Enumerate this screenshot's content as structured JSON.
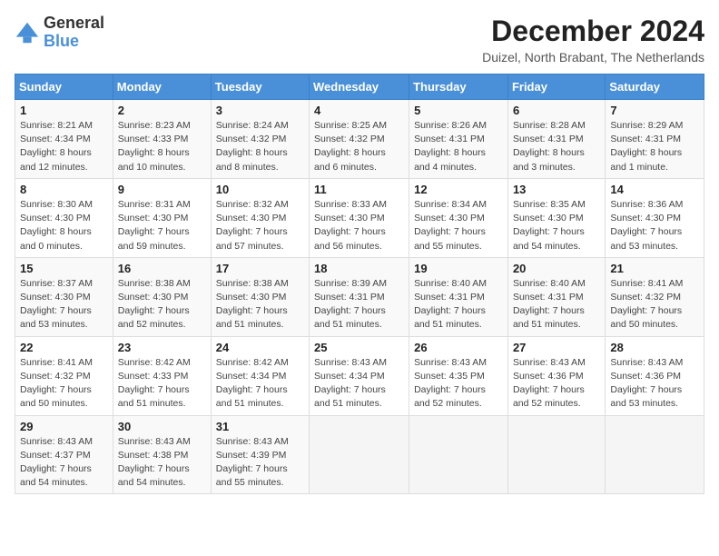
{
  "header": {
    "logo_general": "General",
    "logo_blue": "Blue",
    "title": "December 2024",
    "subtitle": "Duizel, North Brabant, The Netherlands"
  },
  "columns": [
    "Sunday",
    "Monday",
    "Tuesday",
    "Wednesday",
    "Thursday",
    "Friday",
    "Saturday"
  ],
  "weeks": [
    [
      {
        "day": "1",
        "sunrise": "8:21 AM",
        "sunset": "4:34 PM",
        "daylight": "8 hours and 12 minutes."
      },
      {
        "day": "2",
        "sunrise": "8:23 AM",
        "sunset": "4:33 PM",
        "daylight": "8 hours and 10 minutes."
      },
      {
        "day": "3",
        "sunrise": "8:24 AM",
        "sunset": "4:32 PM",
        "daylight": "8 hours and 8 minutes."
      },
      {
        "day": "4",
        "sunrise": "8:25 AM",
        "sunset": "4:32 PM",
        "daylight": "8 hours and 6 minutes."
      },
      {
        "day": "5",
        "sunrise": "8:26 AM",
        "sunset": "4:31 PM",
        "daylight": "8 hours and 4 minutes."
      },
      {
        "day": "6",
        "sunrise": "8:28 AM",
        "sunset": "4:31 PM",
        "daylight": "8 hours and 3 minutes."
      },
      {
        "day": "7",
        "sunrise": "8:29 AM",
        "sunset": "4:31 PM",
        "daylight": "8 hours and 1 minute."
      }
    ],
    [
      {
        "day": "8",
        "sunrise": "8:30 AM",
        "sunset": "4:30 PM",
        "daylight": "8 hours and 0 minutes."
      },
      {
        "day": "9",
        "sunrise": "8:31 AM",
        "sunset": "4:30 PM",
        "daylight": "7 hours and 59 minutes."
      },
      {
        "day": "10",
        "sunrise": "8:32 AM",
        "sunset": "4:30 PM",
        "daylight": "7 hours and 57 minutes."
      },
      {
        "day": "11",
        "sunrise": "8:33 AM",
        "sunset": "4:30 PM",
        "daylight": "7 hours and 56 minutes."
      },
      {
        "day": "12",
        "sunrise": "8:34 AM",
        "sunset": "4:30 PM",
        "daylight": "7 hours and 55 minutes."
      },
      {
        "day": "13",
        "sunrise": "8:35 AM",
        "sunset": "4:30 PM",
        "daylight": "7 hours and 54 minutes."
      },
      {
        "day": "14",
        "sunrise": "8:36 AM",
        "sunset": "4:30 PM",
        "daylight": "7 hours and 53 minutes."
      }
    ],
    [
      {
        "day": "15",
        "sunrise": "8:37 AM",
        "sunset": "4:30 PM",
        "daylight": "7 hours and 53 minutes."
      },
      {
        "day": "16",
        "sunrise": "8:38 AM",
        "sunset": "4:30 PM",
        "daylight": "7 hours and 52 minutes."
      },
      {
        "day": "17",
        "sunrise": "8:38 AM",
        "sunset": "4:30 PM",
        "daylight": "7 hours and 51 minutes."
      },
      {
        "day": "18",
        "sunrise": "8:39 AM",
        "sunset": "4:31 PM",
        "daylight": "7 hours and 51 minutes."
      },
      {
        "day": "19",
        "sunrise": "8:40 AM",
        "sunset": "4:31 PM",
        "daylight": "7 hours and 51 minutes."
      },
      {
        "day": "20",
        "sunrise": "8:40 AM",
        "sunset": "4:31 PM",
        "daylight": "7 hours and 51 minutes."
      },
      {
        "day": "21",
        "sunrise": "8:41 AM",
        "sunset": "4:32 PM",
        "daylight": "7 hours and 50 minutes."
      }
    ],
    [
      {
        "day": "22",
        "sunrise": "8:41 AM",
        "sunset": "4:32 PM",
        "daylight": "7 hours and 50 minutes."
      },
      {
        "day": "23",
        "sunrise": "8:42 AM",
        "sunset": "4:33 PM",
        "daylight": "7 hours and 51 minutes."
      },
      {
        "day": "24",
        "sunrise": "8:42 AM",
        "sunset": "4:34 PM",
        "daylight": "7 hours and 51 minutes."
      },
      {
        "day": "25",
        "sunrise": "8:43 AM",
        "sunset": "4:34 PM",
        "daylight": "7 hours and 51 minutes."
      },
      {
        "day": "26",
        "sunrise": "8:43 AM",
        "sunset": "4:35 PM",
        "daylight": "7 hours and 52 minutes."
      },
      {
        "day": "27",
        "sunrise": "8:43 AM",
        "sunset": "4:36 PM",
        "daylight": "7 hours and 52 minutes."
      },
      {
        "day": "28",
        "sunrise": "8:43 AM",
        "sunset": "4:36 PM",
        "daylight": "7 hours and 53 minutes."
      }
    ],
    [
      {
        "day": "29",
        "sunrise": "8:43 AM",
        "sunset": "4:37 PM",
        "daylight": "7 hours and 54 minutes."
      },
      {
        "day": "30",
        "sunrise": "8:43 AM",
        "sunset": "4:38 PM",
        "daylight": "7 hours and 54 minutes."
      },
      {
        "day": "31",
        "sunrise": "8:43 AM",
        "sunset": "4:39 PM",
        "daylight": "7 hours and 55 minutes."
      },
      null,
      null,
      null,
      null
    ]
  ]
}
